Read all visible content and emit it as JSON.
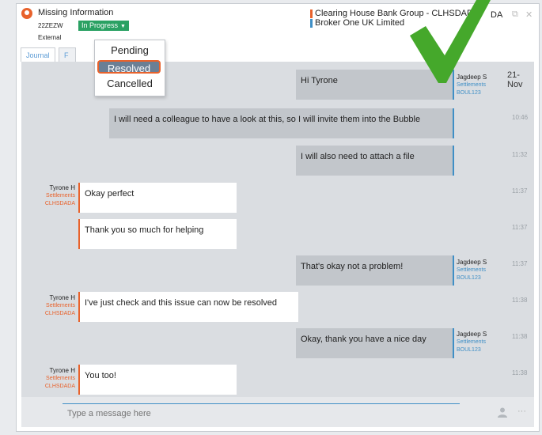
{
  "header": {
    "title": "Missing Information",
    "ref": "22ZEZW",
    "status": "In Progress",
    "type": "External",
    "counterparties": [
      {
        "name": "Clearing House Bank Group - CLHSDADA",
        "color": "#e8622c"
      },
      {
        "name": "Broker One UK Limited",
        "color": "#3f8fc6"
      }
    ],
    "right_text": "DA"
  },
  "tabs": [
    "Journal",
    "F",
    "..."
  ],
  "date": "21-Nov",
  "status_menu": {
    "options": [
      "Pending",
      "Resolved",
      "Cancelled"
    ],
    "selected": "Resolved"
  },
  "messages": [
    {
      "dir": "out",
      "text": "Hi Tyrone",
      "sender": "Jagdeep S",
      "role": "Settlements",
      "code": "BOUL123",
      "time": ""
    },
    {
      "dir": "out",
      "text": "I will need a colleague to have a look at this, so I will invite them into the Bubble",
      "time": "10:46"
    },
    {
      "dir": "out",
      "text": "I will also need to attach a file",
      "time": "11:32"
    },
    {
      "dir": "in",
      "text": "Okay perfect",
      "sender": "Tyrone H",
      "role": "Settlements",
      "code": "CLHSDADA",
      "time": "11:37"
    },
    {
      "dir": "in",
      "text": "Thank you so much for helping",
      "time": "11:37"
    },
    {
      "dir": "out",
      "text": "That's okay not a problem!",
      "sender": "Jagdeep S",
      "role": "Settlements",
      "code": "BOUL123",
      "time": "11:37"
    },
    {
      "dir": "in",
      "text": "I've just check and this issue can now be resolved",
      "sender": "Tyrone H",
      "role": "Settlements",
      "code": "CLHSDADA",
      "time": "11:38"
    },
    {
      "dir": "out",
      "text": "Okay, thank you have a nice day",
      "sender": "Jagdeep S",
      "role": "Settlements",
      "code": "BOUL123",
      "time": "11:38"
    },
    {
      "dir": "in",
      "text": "You too!",
      "sender": "Tyrone H",
      "role": "Settlements",
      "code": "CLHSDADA",
      "time": "11:38"
    }
  ],
  "composer": {
    "placeholder": "Type a message here"
  },
  "colors": {
    "accent_in": "#e8622c",
    "accent_out": "#3f8fc6",
    "status": "#2aa163",
    "check": "#45a82b"
  }
}
